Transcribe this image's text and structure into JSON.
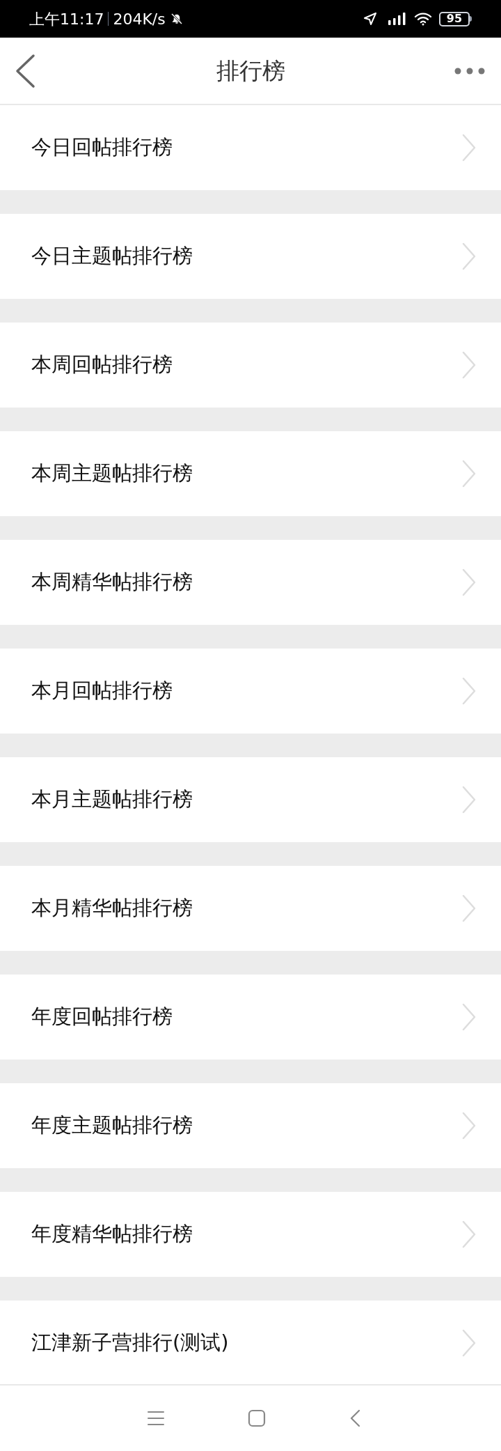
{
  "status_bar": {
    "time": "上午11:17",
    "speed": "204K/s",
    "battery": "95"
  },
  "header": {
    "title": "排行榜"
  },
  "items": [
    {
      "label": "今日回帖排行榜"
    },
    {
      "label": "今日主题帖排行榜"
    },
    {
      "label": "本周回帖排行榜"
    },
    {
      "label": "本周主题帖排行榜"
    },
    {
      "label": "本周精华帖排行榜"
    },
    {
      "label": "本月回帖排行榜"
    },
    {
      "label": "本月主题帖排行榜"
    },
    {
      "label": "本月精华帖排行榜"
    },
    {
      "label": "年度回帖排行榜"
    },
    {
      "label": "年度主题帖排行榜"
    },
    {
      "label": "年度精华帖排行榜"
    },
    {
      "label": "江津新子营排行(测试)"
    }
  ]
}
